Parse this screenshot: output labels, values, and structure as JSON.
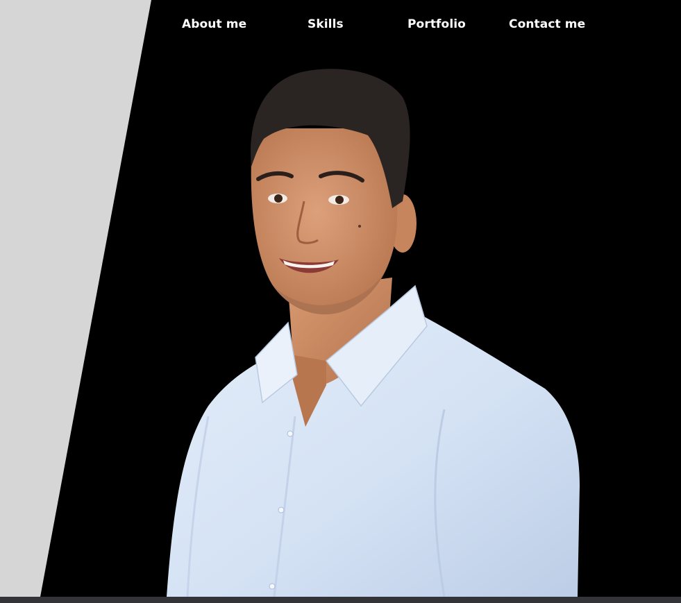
{
  "nav": {
    "items": [
      {
        "label": "About me"
      },
      {
        "label": "Skills"
      },
      {
        "label": "Portfolio"
      },
      {
        "label": "Contact me"
      }
    ]
  },
  "hero": {
    "photo_icon": "portrait-photo"
  },
  "colors": {
    "background": "#000000",
    "side_panel": "#d6d6d6",
    "nav_text": "#ffffff",
    "shirt": "#d3e1f3",
    "skin": "#c98a63",
    "hair": "#2a2522",
    "bottom_bar": "#333438"
  }
}
